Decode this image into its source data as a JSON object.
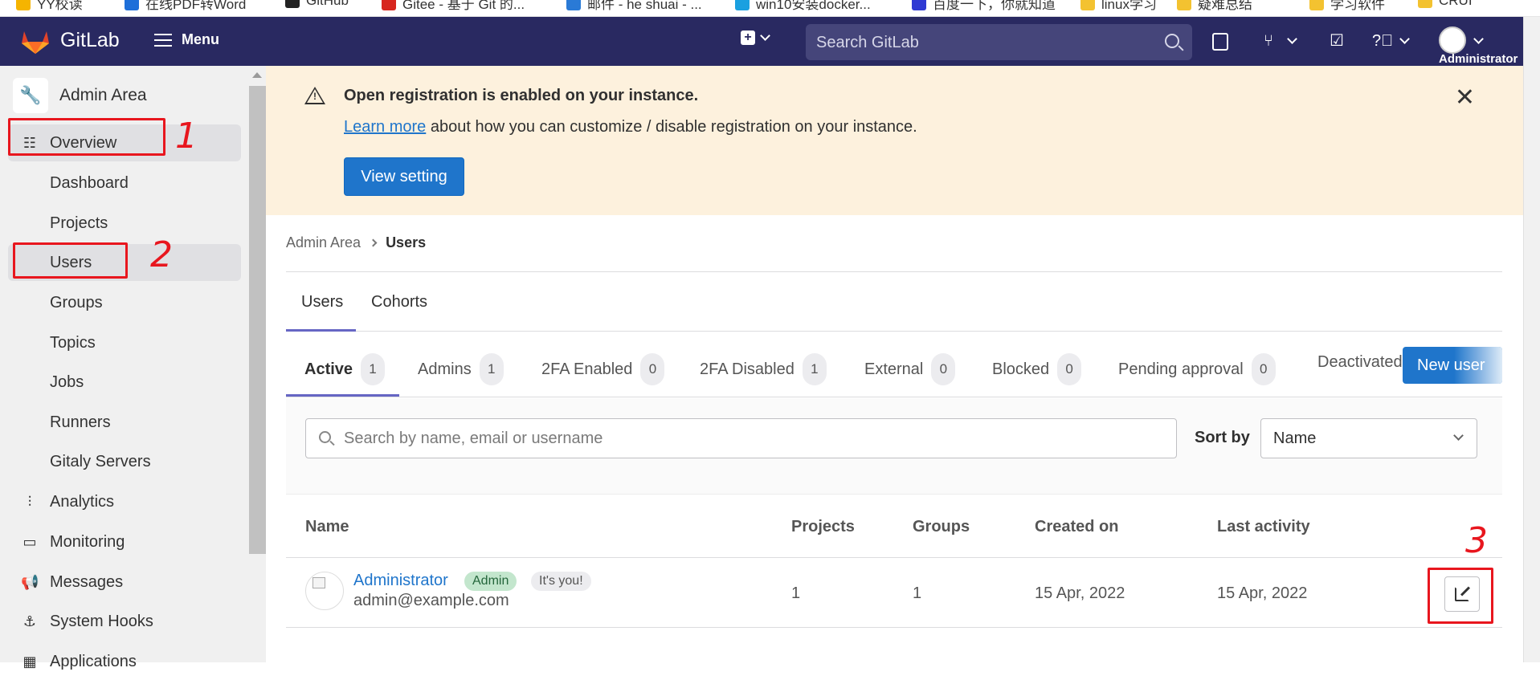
{
  "bookmarks": [
    "YY校读",
    "在线PDF转Word",
    "GitHub",
    "Gitee - 基于 Git 的...",
    "邮件 - he shuai - ...",
    "win10安装docker...",
    "百度一下，你就知道",
    "linux学习",
    "疑难总结",
    "学习软件",
    "CRUI"
  ],
  "topnav": {
    "brand": "GitLab",
    "menu_label": "Menu",
    "search_placeholder": "Search GitLab",
    "user_label": "Administrator"
  },
  "sidebar": {
    "header": "Admin Area",
    "items": [
      {
        "label": "Overview",
        "icon": "overview-icon",
        "kind": "section"
      },
      {
        "label": "Dashboard",
        "kind": "sub"
      },
      {
        "label": "Projects",
        "kind": "sub"
      },
      {
        "label": "Users",
        "kind": "sub"
      },
      {
        "label": "Groups",
        "kind": "sub"
      },
      {
        "label": "Topics",
        "kind": "sub"
      },
      {
        "label": "Jobs",
        "kind": "sub"
      },
      {
        "label": "Runners",
        "kind": "sub"
      },
      {
        "label": "Gitaly Servers",
        "kind": "sub"
      },
      {
        "label": "Analytics",
        "icon": "analytics-icon",
        "kind": "section"
      },
      {
        "label": "Monitoring",
        "icon": "monitoring-icon",
        "kind": "section"
      },
      {
        "label": "Messages",
        "icon": "messages-icon",
        "kind": "section"
      },
      {
        "label": "System Hooks",
        "icon": "hook-icon",
        "kind": "section"
      },
      {
        "label": "Applications",
        "icon": "applications-icon",
        "kind": "section"
      }
    ]
  },
  "alert": {
    "title": "Open registration is enabled on your instance.",
    "link": "Learn more",
    "text": " about how you can customize / disable registration on your instance.",
    "button": "View setting"
  },
  "breadcrumb": {
    "parent": "Admin Area",
    "current": "Users"
  },
  "tabs": [
    "Users",
    "Cohorts"
  ],
  "filter_tabs": [
    {
      "label": "Active",
      "count": "1"
    },
    {
      "label": "Admins",
      "count": "1"
    },
    {
      "label": "2FA Enabled",
      "count": "0"
    },
    {
      "label": "2FA Disabled",
      "count": "1"
    },
    {
      "label": "External",
      "count": "0"
    },
    {
      "label": "Blocked",
      "count": "0"
    },
    {
      "label": "Pending approval",
      "count": "0"
    },
    {
      "label": "Deactivated",
      "count": ""
    }
  ],
  "new_user_button": "New user",
  "search": {
    "placeholder": "Search by name, email or username",
    "sort_label": "Sort by",
    "sort_value": "Name"
  },
  "table": {
    "headers": [
      "Name",
      "Projects",
      "Groups",
      "Created on",
      "Last activity"
    ],
    "rows": [
      {
        "name": "Administrator",
        "badge_admin": "Admin",
        "badge_you": "It's you!",
        "email": "admin@example.com",
        "projects": "1",
        "groups": "1",
        "created": "15 Apr, 2022",
        "last_activity": "15 Apr, 2022"
      }
    ]
  },
  "annotations": [
    "1",
    "2",
    "3"
  ],
  "colors": {
    "nav": "#292961",
    "accent": "#1f75cb",
    "annotation": "#e8161e",
    "alert_bg": "#fdf1dd"
  }
}
